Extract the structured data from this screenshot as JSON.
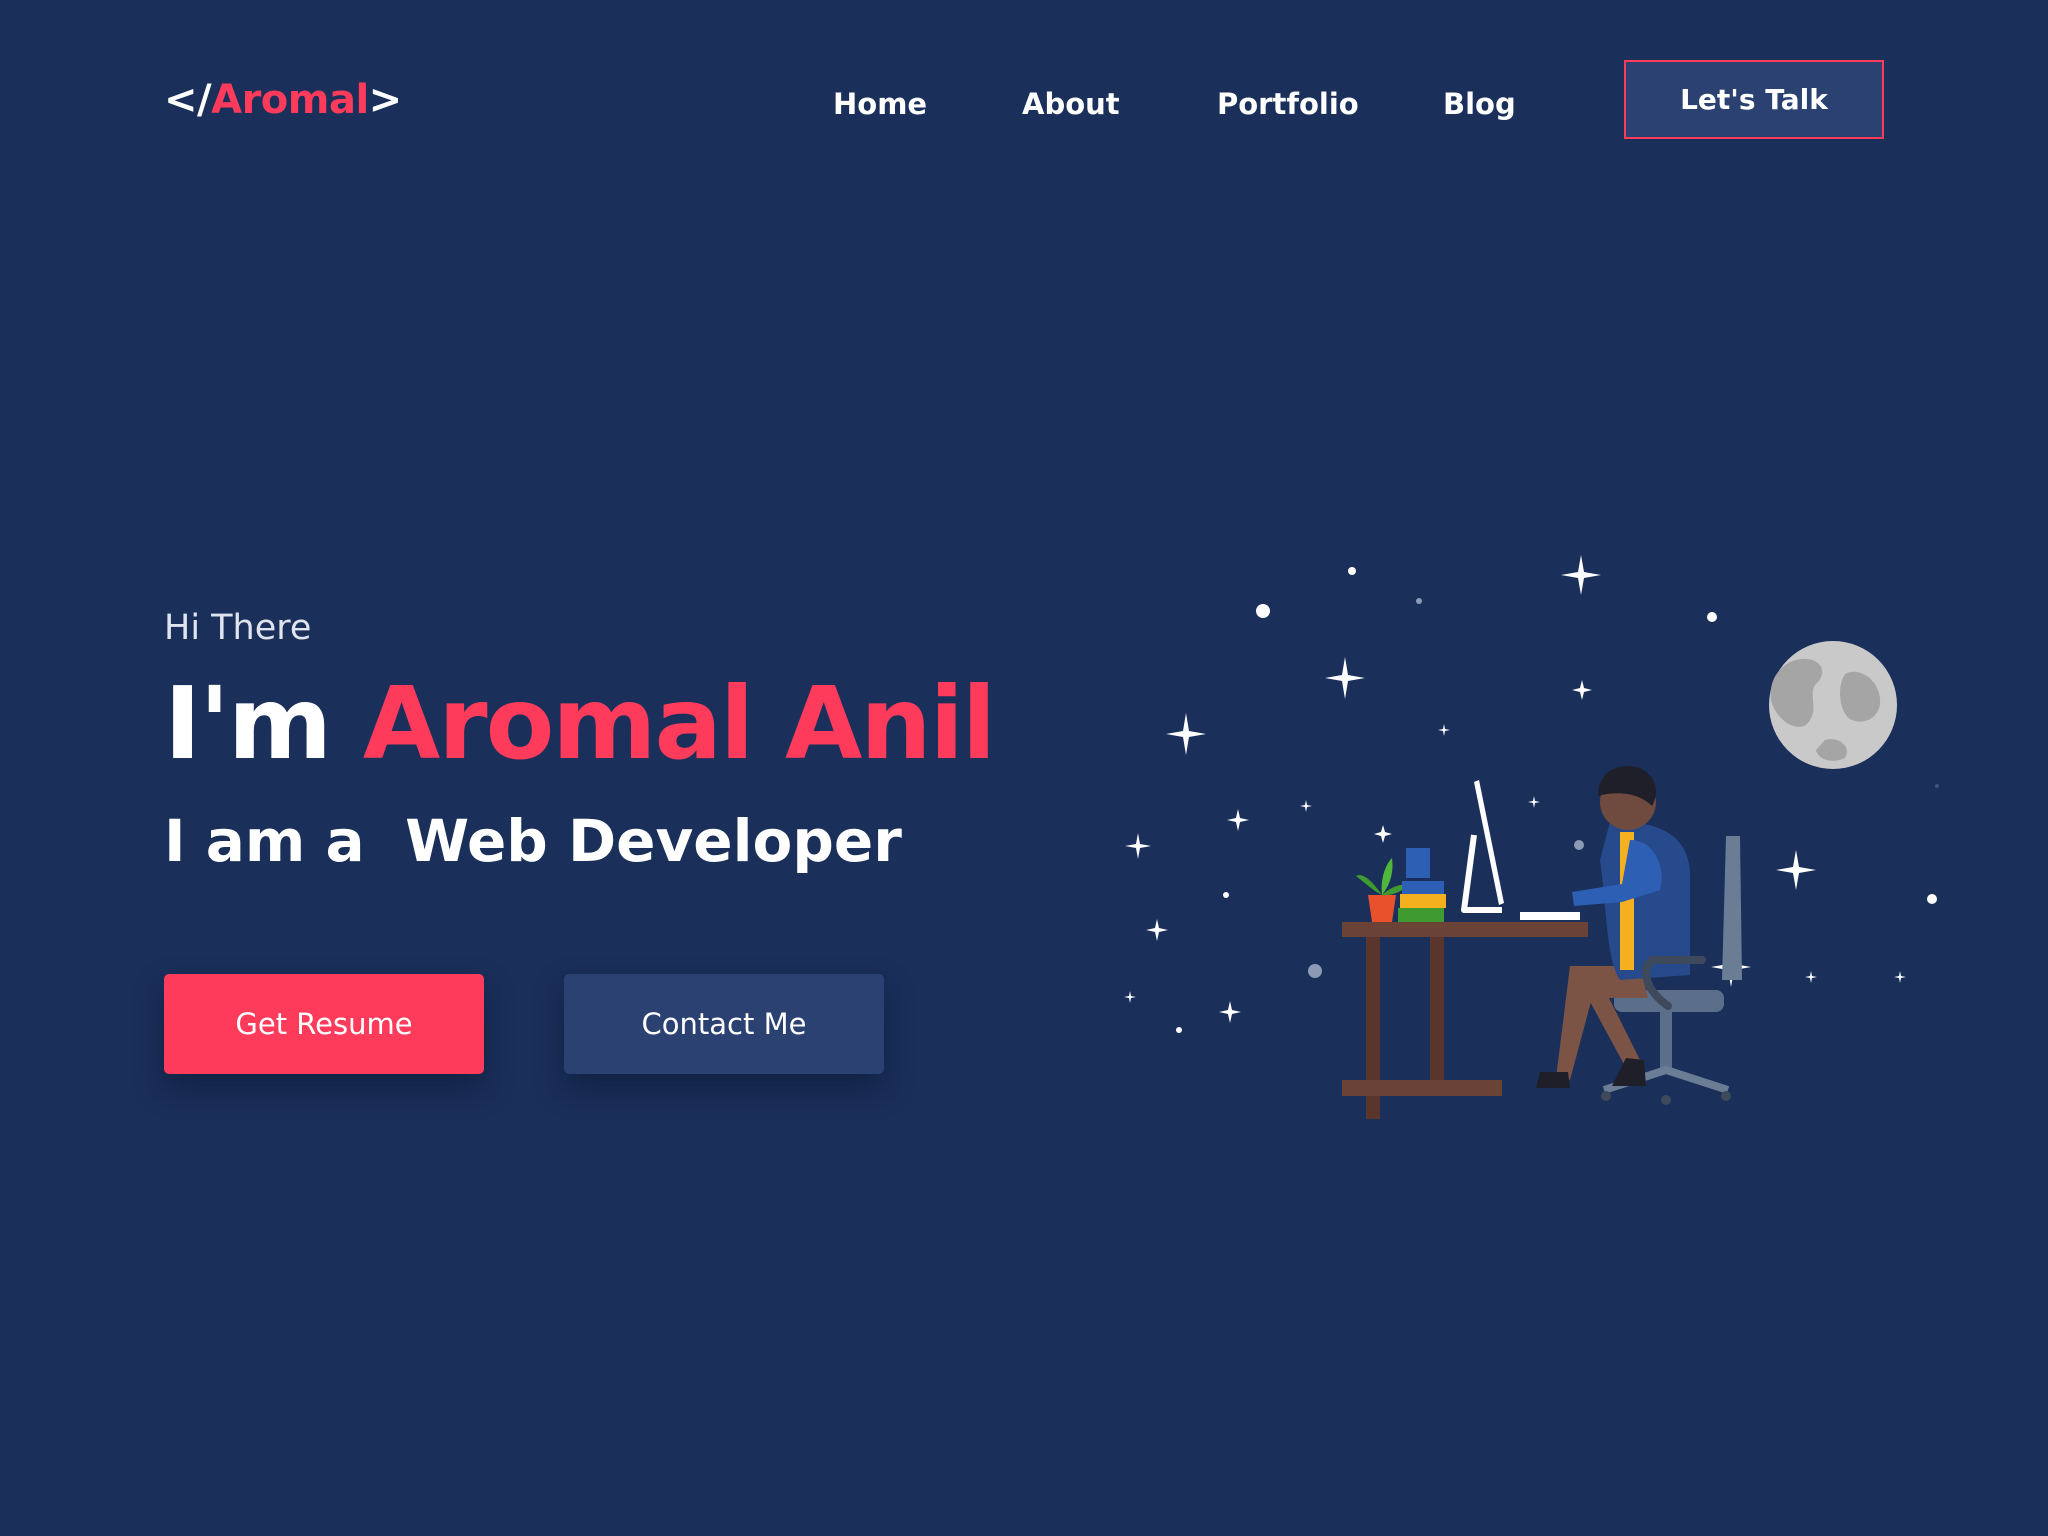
{
  "header": {
    "logo": {
      "prefix": "</",
      "name": "Aromal",
      "suffix": ">"
    },
    "nav": [
      {
        "label": "Home"
      },
      {
        "label": "About"
      },
      {
        "label": "Portfolio"
      },
      {
        "label": "Blog"
      }
    ],
    "cta_label": "Let's Talk"
  },
  "hero": {
    "greeting": "Hi There",
    "headline_prefix": "I'm",
    "name": "Aromal Anil",
    "role": "I am a  Web Developer",
    "buttons": {
      "resume_label": "Get Resume",
      "contact_label": "Contact Me"
    }
  },
  "colors": {
    "background": "#1a2f5a",
    "accent": "#ff3b5c",
    "button_secondary": "#2a4172",
    "text": "#ffffff"
  },
  "illustration": {
    "icons": [
      "star-icon",
      "moon-icon",
      "developer-at-desk"
    ]
  }
}
